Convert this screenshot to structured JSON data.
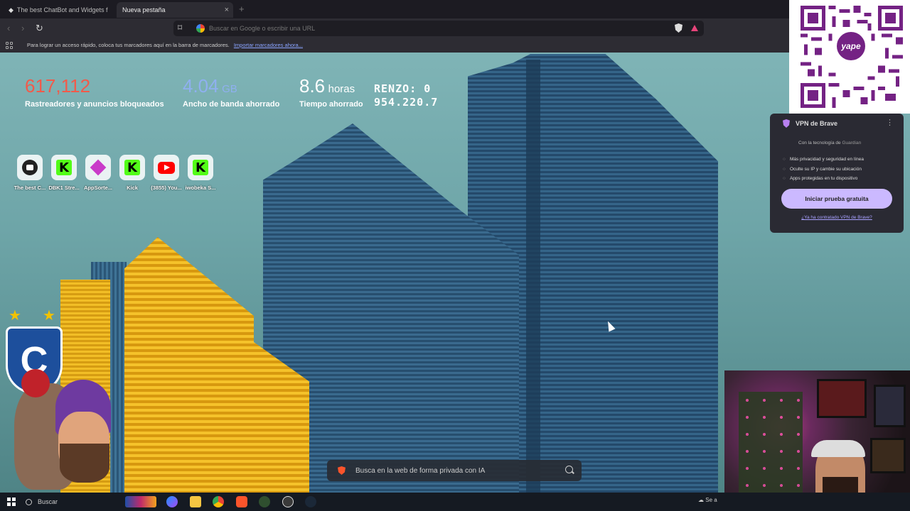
{
  "tabs": [
    {
      "title": "The best ChatBot and Widgets f",
      "active": false
    },
    {
      "title": "Nueva pestaña",
      "active": true
    }
  ],
  "toolbar": {
    "url_placeholder": "Buscar en Google o escribir una URL"
  },
  "bookmarks_bar": {
    "message": "Para lograr un acceso rápido, coloca tus marcadores aquí en la barra de marcadores.",
    "import_link": "Importar marcadores ahora..."
  },
  "stats": [
    {
      "value": "617,112",
      "unit": "",
      "label": "Rastreadores y anuncios bloqueados",
      "color": "#f25a4a"
    },
    {
      "value": "4.04",
      "unit": "GB",
      "label": "Ancho de banda ahorrado",
      "color": "#8fb0f0"
    },
    {
      "value": "8.6",
      "unit": "horas",
      "label": "Tiempo ahorrado",
      "color": "#ffffff"
    }
  ],
  "overlay_text": {
    "line1": "RENZO: 0",
    "line2": "954.220.7"
  },
  "shortcuts": [
    {
      "label": "The best C...",
      "icon": "chatbot-icon"
    },
    {
      "label": "DBK1 Stre...",
      "icon": "kick-icon"
    },
    {
      "label": "AppSorte...",
      "icon": "diamond-icon"
    },
    {
      "label": "Kick",
      "icon": "kick-icon"
    },
    {
      "label": "(3855) You...",
      "icon": "youtube-icon"
    },
    {
      "label": "iwobeka S...",
      "icon": "kick-icon"
    }
  ],
  "vpn": {
    "title": "VPN de Brave",
    "powered_by": "Con la tecnología de",
    "powered_brand": "Guardian",
    "features": [
      "Más privacidad y seguridad en línea",
      "Oculte su IP y cambie su ubicación",
      "Apps protegidas en tu dispositivo"
    ],
    "cta": "Iniciar prueba gratuita",
    "already_link": "¿Ya ha contratado VPN de Brave?"
  },
  "qr": {
    "brand": "yape"
  },
  "search": {
    "placeholder": "Busca en la web de forma privada con IA"
  },
  "taskbar": {
    "search_label": "Buscar",
    "weather_text": "Se a"
  },
  "colors": {
    "accent_vpn": "#cbb9ff",
    "brave_orange": "#fb542b",
    "kick_green": "#53fc18"
  }
}
